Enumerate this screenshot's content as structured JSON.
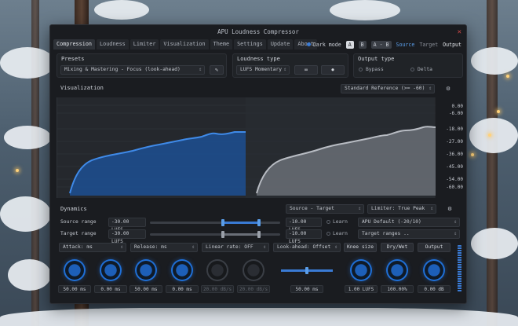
{
  "window": {
    "title": "APU Loudness Compressor",
    "close_glyph": "✕"
  },
  "tabs": [
    "Compression",
    "Loudness",
    "Limiter",
    "Visualization",
    "Theme",
    "Settings",
    "Update",
    "About"
  ],
  "header": {
    "dark_mode": "Dark mode",
    "ab": [
      "A",
      "B",
      "A - B"
    ],
    "views": [
      "Source",
      "Target",
      "Output"
    ]
  },
  "presets": {
    "title": "Presets",
    "value": "Mixing & Mastering - Focus (look-ahead)"
  },
  "loudness_type": {
    "title": "Loudness type",
    "value": "LUFS Momentary",
    "btn1": "∞",
    "btn2": "⏺"
  },
  "output_type": {
    "title": "Output type",
    "options": [
      "Bypass",
      "Delta"
    ]
  },
  "visualization": {
    "title": "Visualization",
    "reference": "Standard Reference (>= -60)",
    "scale": [
      "0.00",
      "-6.00",
      "-18.00",
      "-27.00",
      "-36.00",
      "-45.00",
      "-54.00",
      "-60.00"
    ]
  },
  "dynamics": {
    "title": "Dynamics",
    "mode": "Source - Target",
    "limiter": "Limiter: True Peak",
    "rows": [
      {
        "label": "Source range",
        "min": "-30.00 LUFS",
        "max": "-10.00 LUFS",
        "learn": "Learn",
        "preset": "APU Default (-20/10)"
      },
      {
        "label": "Target range",
        "min": "-30.00 LUFS",
        "max": "-10.00 LUFS",
        "learn": "Learn",
        "preset": "Target ranges .."
      }
    ],
    "params": [
      "Attack: ms",
      "Release: ms",
      "Linear rate: OFF",
      "Look-ahead: Offset"
    ],
    "buttons": [
      "Knee size",
      "Dry/Wet",
      "Output"
    ],
    "knob_values": [
      "50.00 ms",
      "0.00 ms",
      "50.00 ms",
      "0.00 ms",
      "20.00 dB/s",
      "20.00 dB/s",
      "50.00 ms",
      "1.00 LUFS",
      "100.00%",
      "0.00 dB"
    ]
  }
}
